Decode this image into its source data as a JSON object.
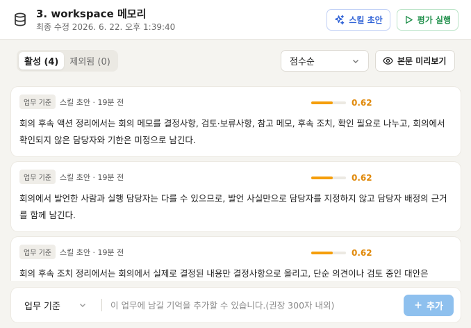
{
  "header": {
    "title": "3. workspace 메모리",
    "subtitle": "최종 수정 2026. 6. 22. 오후 1:39:40",
    "skill_draft_label": "스킬 초안",
    "run_eval_label": "평가 실행"
  },
  "toolbar": {
    "tab_active": "활성 (4)",
    "tab_excluded": "제외됨 (0)",
    "sort_value": "점수순",
    "preview_label": "본문 미리보기"
  },
  "cards": [
    {
      "badge": "업무 기준",
      "meta": "스킬 초안 · 19분 전",
      "score": "0.62",
      "score_fraction": 0.62,
      "text": "회의 후속 액션 정리에서는 회의 메모를 결정사항, 검토·보류사항, 참고 메모, 후속 조치, 확인 필요로 나누고, 회의에서 확인되지 않은 담당자와 기한은 미정으로 남긴다."
    },
    {
      "badge": "업무 기준",
      "meta": "스킬 초안 · 19분 전",
      "score": "0.62",
      "score_fraction": 0.62,
      "text": "회의에서 발언한 사람과 실행 담당자는 다를 수 있으므로, 발언 사실만으로 담당자를 지정하지 않고 담당자 배정의 근거를 함께 남긴다."
    },
    {
      "badge": "업무 기준",
      "meta": "스킬 초안 · 19분 전",
      "score": "0.62",
      "score_fraction": 0.62,
      "text": "회의 후속 조치 정리에서는 회의에서 실제로 결정된 내용만 결정사항으로 올리고, 단순 의견이나 검토 중인 대안은"
    }
  ],
  "composer": {
    "type_value": "업무 기준",
    "placeholder": "이 업무에 남길 기억을 추가할 수 있습니다.(권장 300자 내외)",
    "add_label": "추가"
  },
  "colors": {
    "accent_blue": "#2f62d6",
    "accent_green": "#1f8f4a",
    "score_orange": "#f59e0b",
    "add_button": "#8ec0ee"
  }
}
